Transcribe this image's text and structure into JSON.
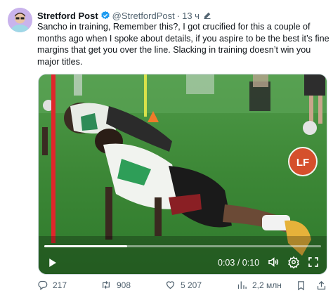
{
  "author": {
    "name": "Stretford Post",
    "handle": "@StretfordPost",
    "separator": "·",
    "time": "13 ч"
  },
  "tweet": {
    "lines": [
      "Sancho in training, Remember this?, I got crucified for this a couple of",
      "months ago when I spoke about details, if you aspire to be the best it’s fine",
      "margins that get you over the line. Slacking in training doesn’t win you",
      "major titles."
    ]
  },
  "video": {
    "current_time": "0:03",
    "duration": "0:10",
    "time_separator": "/",
    "progress_fraction": 0.3,
    "watermark": "LF"
  },
  "actions": {
    "replies": "217",
    "reposts": "908",
    "likes": "5 207",
    "views": "2,2 млн"
  },
  "colors": {
    "text": "#0f1419",
    "secondary": "#536471",
    "verified": "#1d9bf0",
    "pitch": "#3f8a3b"
  }
}
